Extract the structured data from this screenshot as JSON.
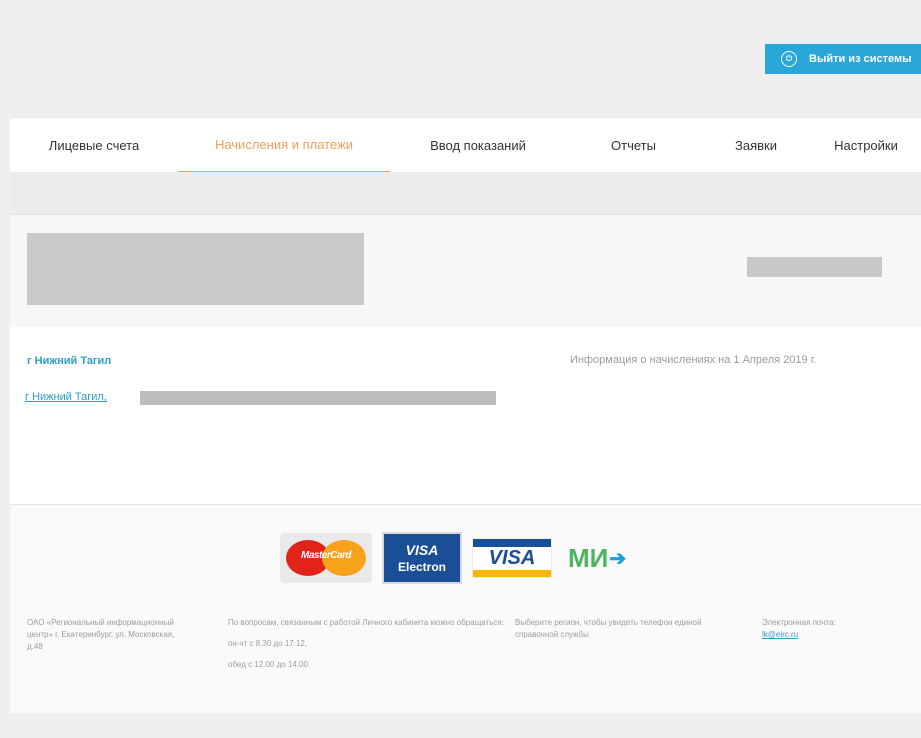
{
  "header": {
    "logout_label": "Выйти из системы"
  },
  "nav": {
    "tabs": [
      {
        "label": "Лицевые счета",
        "active": false
      },
      {
        "label": "Начисления и платежи",
        "active": true
      },
      {
        "label": "Ввод показаний",
        "active": false
      },
      {
        "label": "Отчеты",
        "active": false
      },
      {
        "label": "Заявки",
        "active": false
      },
      {
        "label": "Настройки",
        "active": false
      }
    ]
  },
  "account": {
    "city_title": "г Нижний Тагил",
    "accrual_info": "Информация о начислениях на 1 Апреля 2019 г.",
    "address_prefix": "г Нижний Тагил,"
  },
  "footer": {
    "payment_cards": {
      "mastercard": "MasterCard",
      "visa_electron_top": "VISA",
      "visa_electron_bottom": "Electron",
      "visa": "VISA",
      "mir": "МИ"
    },
    "company": "ОАО «Региональный информационный центр» г. Екатеринбург, ул. Московская, д.48",
    "questions": "По вопросам, связанным с работой Личного кабинета можно обращаться:",
    "hours": "пн-чт с 8.30 до 17.12,",
    "lunch": "обед с 12.00 до 14.00",
    "region_note": "Выберите регион, чтобы увидеть телефон единой справочной службы",
    "email_label": "Электронная почта:",
    "email": "lk@eirc.ru"
  },
  "colors": {
    "accent": "#29a7d8",
    "active_tab": "#f0a05a",
    "link": "#2a9fc8"
  }
}
